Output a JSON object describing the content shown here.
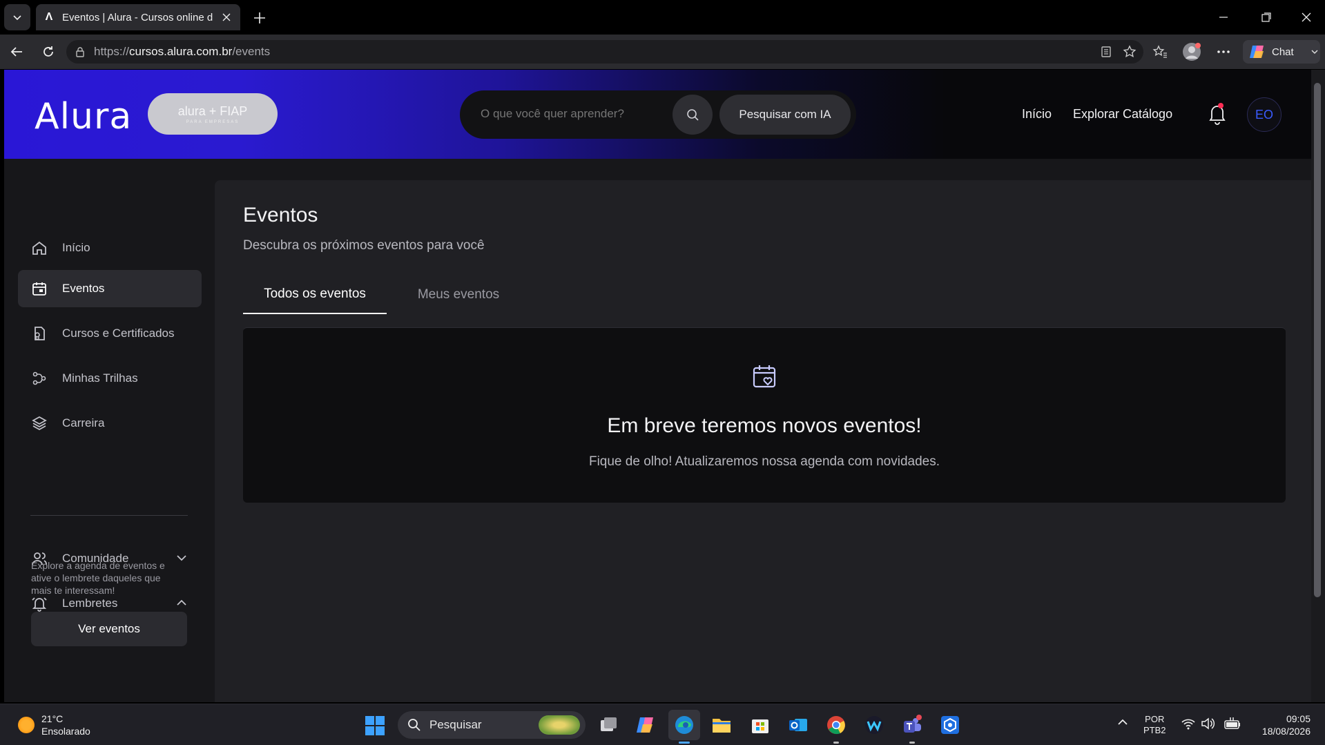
{
  "browser": {
    "tab_title": "Eventos | Alura - Cursos online de",
    "url_prefix": "https://",
    "url_domain": "cursos.alura.com.br",
    "url_path": "/events",
    "chat_label": "Chat"
  },
  "header": {
    "logo": "Alura",
    "partner_logo": "alura + FIAP",
    "partner_tagline": "PARA EMPRESAS",
    "search_placeholder": "O que você quer aprender?",
    "ai_button": "Pesquisar com IA",
    "nav": [
      "Início",
      "Explorar Catálogo"
    ],
    "avatar_initials": "EO"
  },
  "sidebar": {
    "items": [
      {
        "label": "Início",
        "icon": "home-icon"
      },
      {
        "label": "Eventos",
        "icon": "calendar-icon",
        "active": true
      },
      {
        "label": "Cursos e Certificados",
        "icon": "certificate-icon"
      },
      {
        "label": "Minhas Trilhas",
        "icon": "route-icon"
      },
      {
        "label": "Carreira",
        "icon": "layers-icon"
      }
    ],
    "community": {
      "label": "Comunidade",
      "icon": "users-icon",
      "expanded": false
    },
    "reminders": {
      "label": "Lembretes",
      "icon": "bell-icon",
      "expanded": true,
      "text": "Explore a agenda de eventos e ative o lembrete daqueles que mais te interessam!",
      "button": "Ver eventos"
    }
  },
  "main": {
    "title": "Eventos",
    "subtitle": "Descubra os próximos eventos para você",
    "tabs": [
      {
        "label": "Todos os eventos",
        "active": true
      },
      {
        "label": "Meus eventos",
        "active": false
      }
    ],
    "empty": {
      "icon": "calendar-heart-icon",
      "title": "Em breve teremos novos eventos!",
      "subtitle": "Fique de olho! Atualizaremos nossa agenda com novidades."
    }
  },
  "taskbar": {
    "weather_temp": "21°C",
    "weather_desc": "Ensolarado",
    "search": "Pesquisar",
    "lang_top": "POR",
    "lang_bottom": "PTB2",
    "time": "09:05",
    "date": "18/08/2026"
  },
  "colors": {
    "header_gradient_start": "#2a17d6",
    "page_bg": "#17171a",
    "main_bg": "#202024",
    "card_bg": "#0e0e10",
    "avatar_text": "#3a5bff"
  }
}
